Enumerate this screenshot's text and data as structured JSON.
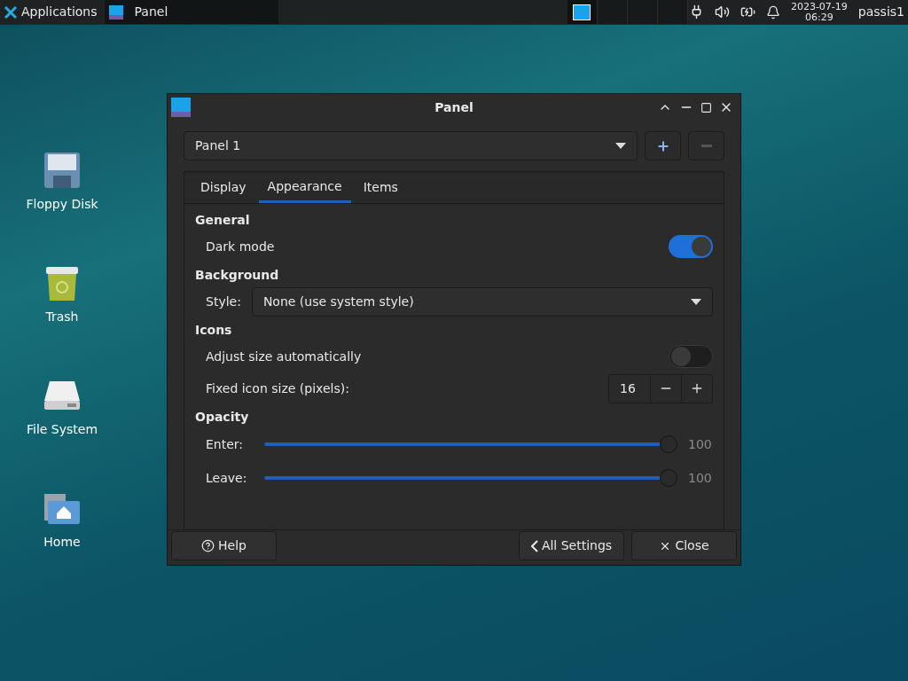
{
  "taskbar": {
    "menu_label": "Applications",
    "windows": [
      {
        "title": "Panel",
        "selected": true
      }
    ],
    "workspaces": [
      {
        "selected": true
      },
      {
        "selected": false
      },
      {
        "selected": false
      },
      {
        "selected": false
      }
    ],
    "date": "2023-07-19",
    "time": "06:29",
    "user": "passis1"
  },
  "desktop_icons": [
    {
      "kind": "floppy",
      "label": "Floppy Disk"
    },
    {
      "kind": "trash",
      "label": "Trash"
    },
    {
      "kind": "drive",
      "label": "File System"
    },
    {
      "kind": "home",
      "label": "Home"
    }
  ],
  "window": {
    "title": "Panel",
    "panel_select": "Panel 1",
    "tabs": [
      {
        "label": "Display",
        "selected": false
      },
      {
        "label": "Appearance",
        "selected": true
      },
      {
        "label": "Items",
        "selected": false
      }
    ],
    "sections": [
      {
        "heading": "General",
        "rows": [
          {
            "kind": "toggle",
            "label": "Dark mode",
            "on": true
          }
        ]
      },
      {
        "heading": "Background",
        "rows": [
          {
            "kind": "select",
            "label": "Style:",
            "value": "None (use system style)"
          }
        ]
      },
      {
        "heading": "Icons",
        "rows": [
          {
            "kind": "toggle",
            "label": "Adjust size automatically",
            "on": false
          },
          {
            "kind": "spin",
            "label": "Fixed icon size (pixels):",
            "value": "16"
          }
        ]
      },
      {
        "heading": "Opacity",
        "rows": [
          {
            "kind": "slider",
            "label": "Enter:",
            "level": 1,
            "reading": "100"
          },
          {
            "kind": "slider",
            "label": "Leave:",
            "level": 1,
            "reading": "100"
          }
        ]
      }
    ],
    "buttons": [
      {
        "kind": "help",
        "label": "Help"
      },
      {
        "kind": "back",
        "label": "All Settings"
      },
      {
        "kind": "close",
        "label": "Close"
      }
    ]
  }
}
